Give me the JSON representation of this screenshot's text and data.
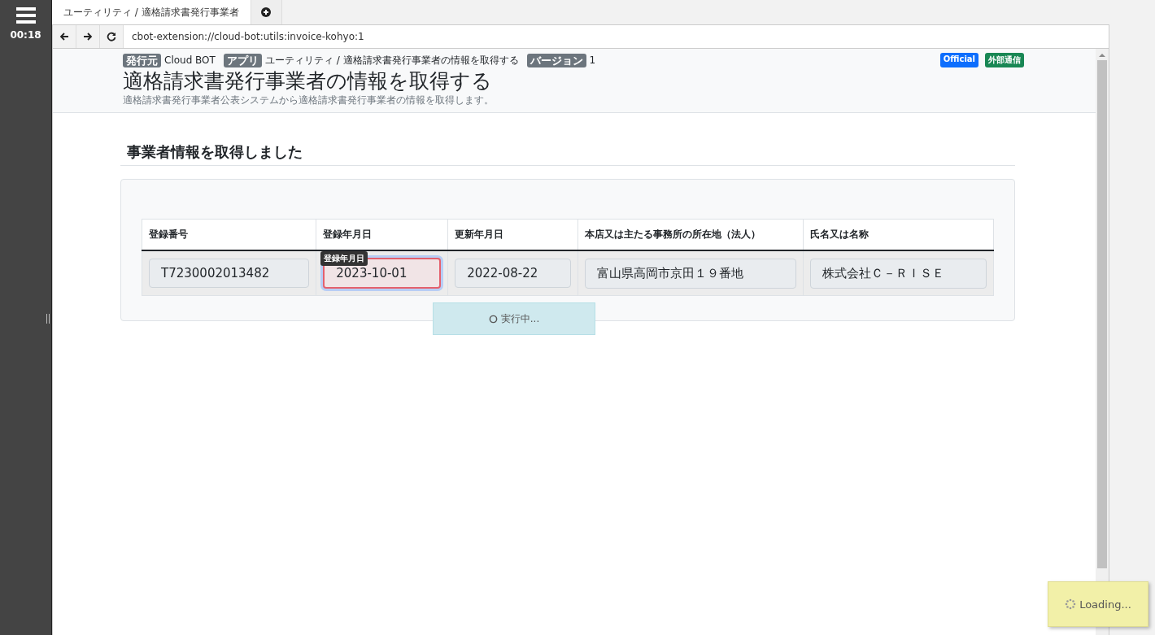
{
  "sidebar": {
    "timer": "00:18"
  },
  "tabs": [
    {
      "label": "ユーティリティ / 適格請求書発行事業者",
      "selected": true
    }
  ],
  "address_bar": {
    "url": "cbot-extension://cloud-bot:utils:invoice-kohyo:1"
  },
  "header": {
    "meta": [
      {
        "badge": "発行元",
        "value": "Cloud BOT"
      },
      {
        "badge": "アプリ",
        "value": "ユーティリティ / 適格請求書発行事業者の情報を取得する"
      },
      {
        "badge": "バージョン",
        "value": "1"
      }
    ],
    "tags": [
      {
        "label": "Official",
        "color": "#0d6efd"
      },
      {
        "label": "外部通信",
        "color": "#198754"
      }
    ],
    "title": "適格請求書発行事業者の情報を取得する",
    "description": "適格請求書発行事業者公表システムから適格請求書発行事業者の情報を取得します。"
  },
  "section_title": "事業者情報を取得しました",
  "table": {
    "columns": [
      "登録番号",
      "登録年月日",
      "更新年月日",
      "本店又は主たる事務所の所在地（法人）",
      "氏名又は名称"
    ],
    "cells": [
      {
        "value": "T7230002013482",
        "invalid": false
      },
      {
        "value": "2023-10-01",
        "invalid": true,
        "tooltip": "登録年月日"
      },
      {
        "value": "2022-08-22",
        "invalid": false
      },
      {
        "value": "富山県高岡市京田１９番地",
        "invalid": false
      },
      {
        "value": "株式会社Ｃ－ＲＩＳＥ",
        "invalid": false
      }
    ]
  },
  "running_status": "実行中...",
  "loading_toast": "Loading..."
}
